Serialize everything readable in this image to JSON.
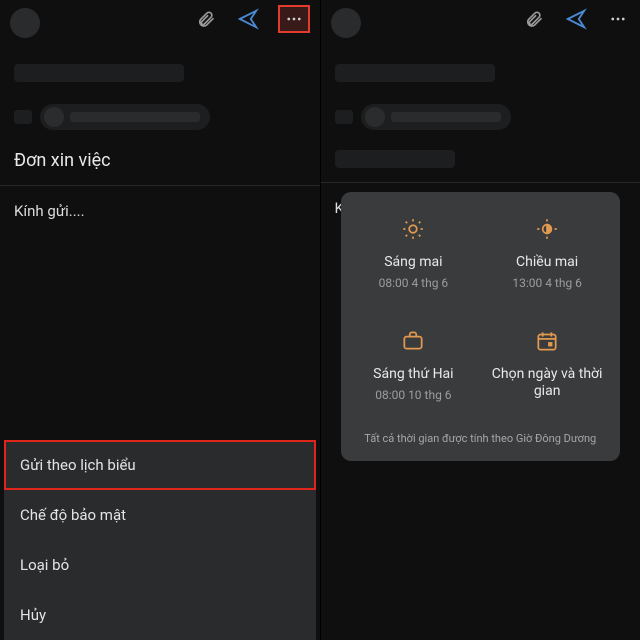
{
  "left": {
    "subject": "Đơn xin việc",
    "body_greeting": "Kính gửi....",
    "menu": {
      "schedule": "Gửi theo lịch biểu",
      "confidential": "Chế độ bảo mật",
      "discard": "Loại bỏ",
      "cancel": "Hủy"
    }
  },
  "right": {
    "body_greeting": "Kính gửi....",
    "schedule": {
      "opt1": {
        "title": "Sáng mai",
        "sub": "08:00 4 thg 6"
      },
      "opt2": {
        "title": "Chiều mai",
        "sub": "13:00 4 thg 6"
      },
      "opt3": {
        "title": "Sáng thứ Hai",
        "sub": "08:00 10 thg 6"
      },
      "opt4": {
        "title": "Chọn ngày và thời gian",
        "sub": ""
      },
      "footer": "Tất cả thời gian được tính theo Giờ Đông Dương"
    }
  },
  "colors": {
    "accent": "#e39a4e",
    "highlight_border": "#e0261a"
  }
}
